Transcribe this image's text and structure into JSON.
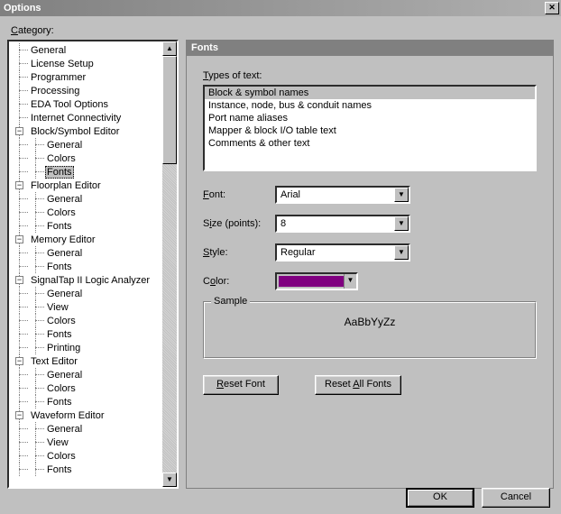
{
  "title": "Options",
  "category_label": "Category:",
  "tree": [
    {
      "depth": 0,
      "box": null,
      "label": "General"
    },
    {
      "depth": 0,
      "box": null,
      "label": "License Setup"
    },
    {
      "depth": 0,
      "box": null,
      "label": "Programmer"
    },
    {
      "depth": 0,
      "box": null,
      "label": "Processing"
    },
    {
      "depth": 0,
      "box": null,
      "label": "EDA Tool Options"
    },
    {
      "depth": 0,
      "box": null,
      "label": "Internet Connectivity"
    },
    {
      "depth": 0,
      "box": "minus",
      "label": "Block/Symbol Editor"
    },
    {
      "depth": 1,
      "box": null,
      "label": "General"
    },
    {
      "depth": 1,
      "box": null,
      "label": "Colors"
    },
    {
      "depth": 1,
      "box": null,
      "label": "Fonts",
      "selected": true
    },
    {
      "depth": 0,
      "box": "minus",
      "label": "Floorplan Editor"
    },
    {
      "depth": 1,
      "box": null,
      "label": "General"
    },
    {
      "depth": 1,
      "box": null,
      "label": "Colors"
    },
    {
      "depth": 1,
      "box": null,
      "label": "Fonts"
    },
    {
      "depth": 0,
      "box": "minus",
      "label": "Memory Editor"
    },
    {
      "depth": 1,
      "box": null,
      "label": "General"
    },
    {
      "depth": 1,
      "box": null,
      "label": "Fonts"
    },
    {
      "depth": 0,
      "box": "minus",
      "label": "SignalTap II Logic Analyzer"
    },
    {
      "depth": 1,
      "box": null,
      "label": "General"
    },
    {
      "depth": 1,
      "box": null,
      "label": "View"
    },
    {
      "depth": 1,
      "box": null,
      "label": "Colors"
    },
    {
      "depth": 1,
      "box": null,
      "label": "Fonts"
    },
    {
      "depth": 1,
      "box": null,
      "label": "Printing"
    },
    {
      "depth": 0,
      "box": "minus",
      "label": "Text Editor"
    },
    {
      "depth": 1,
      "box": null,
      "label": "General"
    },
    {
      "depth": 1,
      "box": null,
      "label": "Colors"
    },
    {
      "depth": 1,
      "box": null,
      "label": "Fonts"
    },
    {
      "depth": 0,
      "box": "minus",
      "label": "Waveform Editor"
    },
    {
      "depth": 1,
      "box": null,
      "label": "General"
    },
    {
      "depth": 1,
      "box": null,
      "label": "View"
    },
    {
      "depth": 1,
      "box": null,
      "label": "Colors"
    },
    {
      "depth": 1,
      "box": null,
      "label": "Fonts"
    }
  ],
  "panel": {
    "title": "Fonts",
    "types_label": "Types of text:",
    "types": [
      "Block & symbol names",
      "Instance, node, bus & conduit names",
      "Port name aliases",
      "Mapper & block I/O table text",
      "Comments & other text"
    ],
    "types_selected": 0,
    "font_label": "Font:",
    "font_value": "Arial",
    "size_label": "Size (points):",
    "size_value": "8",
    "style_label": "Style:",
    "style_value": "Regular",
    "color_label": "Color:",
    "color_value": "#800080",
    "sample_label": "Sample",
    "sample_text": "AaBbYyZz",
    "reset_font": "Reset Font",
    "reset_all": "Reset All Fonts"
  },
  "buttons": {
    "ok": "OK",
    "cancel": "Cancel"
  }
}
